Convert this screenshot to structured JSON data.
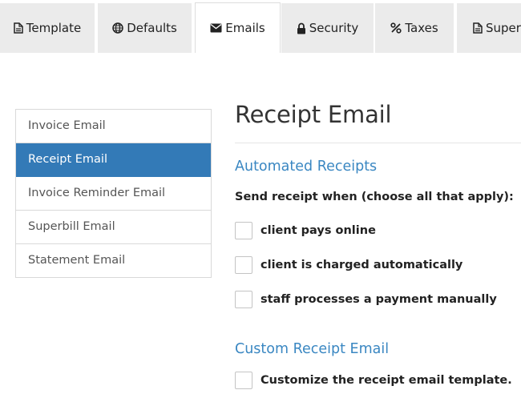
{
  "tabs": [
    {
      "label": "Template",
      "icon": "file-icon",
      "active": false
    },
    {
      "label": "Defaults",
      "icon": "globe-icon",
      "active": false
    },
    {
      "label": "Emails",
      "icon": "envelope-icon",
      "active": true
    },
    {
      "label": "Security",
      "icon": "lock-icon",
      "active": false
    },
    {
      "label": "Taxes",
      "icon": "percent-icon",
      "active": false
    },
    {
      "label": "Superbill",
      "icon": "file-icon",
      "active": false
    }
  ],
  "sidebar": {
    "items": [
      {
        "label": "Invoice Email",
        "active": false
      },
      {
        "label": "Receipt Email",
        "active": true
      },
      {
        "label": "Invoice Reminder Email",
        "active": false
      },
      {
        "label": "Superbill Email",
        "active": false
      },
      {
        "label": "Statement Email",
        "active": false
      }
    ]
  },
  "main": {
    "title": "Receipt Email",
    "automated": {
      "heading": "Automated Receipts",
      "prompt": "Send receipt when (choose all that apply):",
      "options": [
        {
          "label": "client pays online",
          "checked": false
        },
        {
          "label": "client is charged automatically",
          "checked": false
        },
        {
          "label": "staff processes a payment manually",
          "checked": false
        }
      ]
    },
    "custom": {
      "heading": "Custom Receipt Email",
      "option": {
        "label": "Customize the receipt email template.",
        "checked": false
      }
    }
  },
  "colors": {
    "accent": "#337ab7",
    "heading": "#3a87c2",
    "tab_bg": "#ebebeb"
  }
}
